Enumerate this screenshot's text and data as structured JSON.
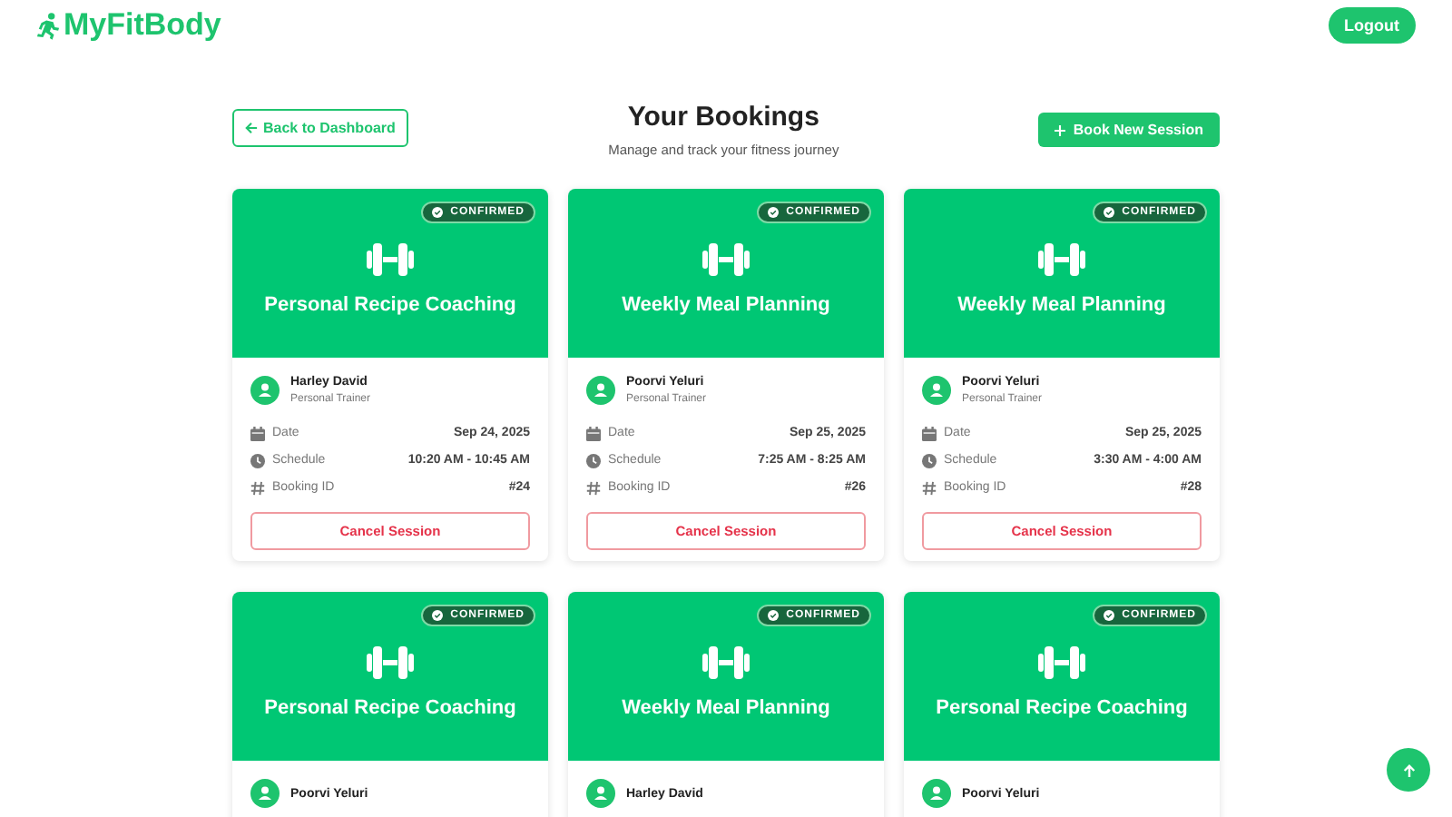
{
  "header": {
    "logo": "MyFitBody",
    "logout": "Logout"
  },
  "page": {
    "back": "Back to Dashboard",
    "title": "Your Bookings",
    "subtitle": "Manage and track your fitness journey",
    "book": "Book New Session"
  },
  "bookings": [
    {
      "status": "CONFIRMED",
      "service": "Personal Recipe Coaching",
      "trainer": "Harley David",
      "role": "Personal Trainer",
      "details": [
        {
          "kind": "date",
          "label": "Date",
          "value": "Sep 24, 2025"
        },
        {
          "kind": "schedule",
          "label": "Schedule",
          "value": "10:20 AM - 10:45 AM"
        },
        {
          "kind": "id",
          "label": "Booking ID",
          "value": "#24"
        }
      ],
      "action": "Cancel Session"
    },
    {
      "status": "CONFIRMED",
      "service": "Weekly Meal Planning",
      "trainer": "Poorvi Yeluri",
      "role": "Personal Trainer",
      "details": [
        {
          "kind": "date",
          "label": "Date",
          "value": "Sep 25, 2025"
        },
        {
          "kind": "schedule",
          "label": "Schedule",
          "value": "7:25 AM - 8:25 AM"
        },
        {
          "kind": "id",
          "label": "Booking ID",
          "value": "#26"
        }
      ],
      "action": "Cancel Session"
    },
    {
      "status": "CONFIRMED",
      "service": "Weekly Meal Planning",
      "trainer": "Poorvi Yeluri",
      "role": "Personal Trainer",
      "details": [
        {
          "kind": "date",
          "label": "Date",
          "value": "Sep 25, 2025"
        },
        {
          "kind": "schedule",
          "label": "Schedule",
          "value": "3:30 AM - 4:00 AM"
        },
        {
          "kind": "id",
          "label": "Booking ID",
          "value": "#28"
        }
      ],
      "action": "Cancel Session"
    },
    {
      "status": "CONFIRMED",
      "service": "Personal Recipe Coaching",
      "trainer": "Poorvi Yeluri"
    },
    {
      "status": "CONFIRMED",
      "service": "Weekly Meal Planning",
      "trainer": "Harley David"
    },
    {
      "status": "CONFIRMED",
      "service": "Personal Recipe Coaching",
      "trainer": "Poorvi Yeluri"
    }
  ]
}
